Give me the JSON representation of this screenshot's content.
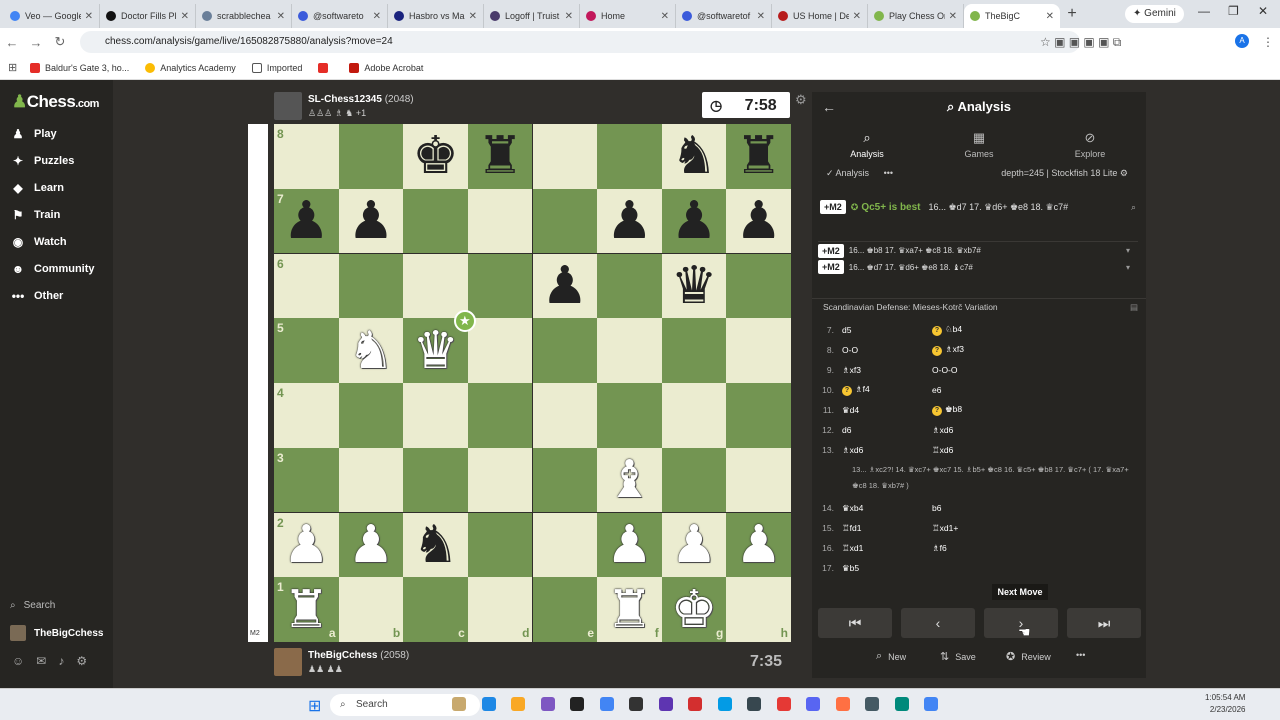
{
  "browser": {
    "tabs": [
      {
        "title": "Veo — Google",
        "color": "#4285f4"
      },
      {
        "title": "Doctor Fills Pl",
        "color": "#111111"
      },
      {
        "title": "scrabblechea",
        "color": "#6a7f99"
      },
      {
        "title": "@softwareto",
        "color": "#3b5bdb"
      },
      {
        "title": "Hasbro vs Ma",
        "color": "#1a237e"
      },
      {
        "title": "Logoff | Truist",
        "color": "#4a3b6b"
      },
      {
        "title": "Home",
        "color": "#c2185b"
      },
      {
        "title": "@softwaretof",
        "color": "#3b5bdb"
      },
      {
        "title": "US Home | De",
        "color": "#b71c1c"
      },
      {
        "title": "Play Chess Or",
        "color": "#81b64c"
      },
      {
        "title": "TheBigC",
        "color": "#81b64c"
      }
    ],
    "gemini_label": "Gemini",
    "url": "chess.com/analysis/game/live/165082875880/analysis?move=24",
    "bookmarks": [
      "Baldur's Gate 3, ho...",
      "Analytics Academy",
      "Imported",
      "",
      "Adobe Acrobat"
    ]
  },
  "sidebar": {
    "logo_text": "Chess",
    "logo_suffix": ".com",
    "items": [
      {
        "label": "Play",
        "icon": "♟"
      },
      {
        "label": "Puzzles",
        "icon": "✦"
      },
      {
        "label": "Learn",
        "icon": "◆"
      },
      {
        "label": "Train",
        "icon": "⚑"
      },
      {
        "label": "Watch",
        "icon": "◉"
      },
      {
        "label": "Community",
        "icon": "☻"
      },
      {
        "label": "Other",
        "icon": "•••"
      }
    ],
    "search_label": "Search",
    "username": "TheBigCchess"
  },
  "top_player": {
    "name": "SL-Chess12345",
    "rating": "(2048)",
    "captured": "♙♙♙ ♗ ♞ +1",
    "clock": "7:58"
  },
  "bottom_player": {
    "name": "TheBigCchess",
    "rating": "(2058)",
    "captured": "♟♟ ♟♟",
    "clock": "7:35"
  },
  "board": {
    "rows": [
      [
        "",
        "",
        "bk",
        "br",
        "",
        "",
        "bn",
        "br"
      ],
      [
        "bp",
        "bp",
        "",
        "",
        "",
        "bp",
        "bp",
        "bp"
      ],
      [
        "",
        "",
        "",
        "",
        "bp",
        "",
        "bq",
        ""
      ],
      [
        "",
        "wn",
        "wq",
        "",
        "",
        "",
        "",
        ""
      ],
      [
        "",
        "",
        "",
        "",
        "",
        "",
        "",
        ""
      ],
      [
        "",
        "",
        "",
        "",
        "",
        "wb",
        "",
        ""
      ],
      [
        "wp",
        "wp",
        "bn",
        "",
        "",
        "wp",
        "wp",
        "wp"
      ],
      [
        "wr",
        "",
        "",
        "",
        "",
        "wr",
        "wk",
        ""
      ]
    ],
    "ranks": [
      "8",
      "7",
      "6",
      "5",
      "4",
      "3",
      "2",
      "1"
    ],
    "files": [
      "a",
      "b",
      "c",
      "d",
      "e",
      "f",
      "g",
      "h"
    ],
    "eval_label": "M2"
  },
  "analysis": {
    "title": "Analysis",
    "tabs": [
      {
        "label": "Analysis",
        "icon": "⌕"
      },
      {
        "label": "Games",
        "icon": "▦"
      },
      {
        "label": "Explore",
        "icon": "⊘"
      }
    ],
    "toggle_label": "Analysis",
    "engine": "depth=245 | Stockfish 18 Lite",
    "best_eval": "+M2",
    "best_text": "Qc5+ is best",
    "best_line": "16... ♚d7 17. ♛d6+ ♚e8 18. ♛c7#",
    "lines": [
      {
        "eval": "+M2",
        "text": "16... ♚b8 17. ♛xa7+ ♚c8 18. ♛xb7#"
      },
      {
        "eval": "+M2",
        "text": "16... ♚d7 17. ♛d6+ ♚e8 18. ♝c7#"
      }
    ],
    "opening": "Scandinavian Defense: Mieses-Kotrč Variation",
    "moves": [
      {
        "n": "7.",
        "w": "d5",
        "wi": "",
        "b": "♘b4",
        "bi": "?"
      },
      {
        "n": "8.",
        "w": "O-O",
        "wi": "",
        "b": "♗xf3",
        "bi": "?"
      },
      {
        "n": "9.",
        "w": "♗xf3",
        "wi": "",
        "b": "O-O-O",
        "bi": ""
      },
      {
        "n": "10.",
        "w": "♗f4",
        "wi": "?",
        "b": "e6",
        "bi": ""
      },
      {
        "n": "11.",
        "w": "♛d4",
        "wi": "",
        "b": "♚b8",
        "bi": "?"
      },
      {
        "n": "12.",
        "w": "d6",
        "wi": "",
        "b": "♗xd6",
        "bi": ""
      },
      {
        "n": "13.",
        "w": "♗xd6",
        "wi": "",
        "b": "♖xd6",
        "bi": ""
      }
    ],
    "variation": "13... ♗xc2?! 14. ♛xc7+ ♚xc7 15. ♗b5+ ♚c8 16. ♛c5+ ♚b8 17. ♛c7+ ( 17. ♛xa7+ ♚c8 18. ♛xb7# )",
    "moves2": [
      {
        "n": "14.",
        "w": "♛xb4",
        "b": "b6"
      },
      {
        "n": "15.",
        "w": "♖fd1",
        "b": "♖xd1+"
      },
      {
        "n": "16.",
        "w": "♖xd1",
        "b": "♗f6"
      },
      {
        "n": "17.",
        "w": "♛b5",
        "b": ""
      }
    ],
    "tooltip": "Next Move",
    "actions": [
      {
        "label": "New",
        "icon": "⌕"
      },
      {
        "label": "Save",
        "icon": "⇅"
      },
      {
        "label": "Review",
        "icon": "✪"
      }
    ]
  },
  "taskbar": {
    "search_label": "Search",
    "time": "1:05:54 AM",
    "date": "2/23/2026"
  }
}
